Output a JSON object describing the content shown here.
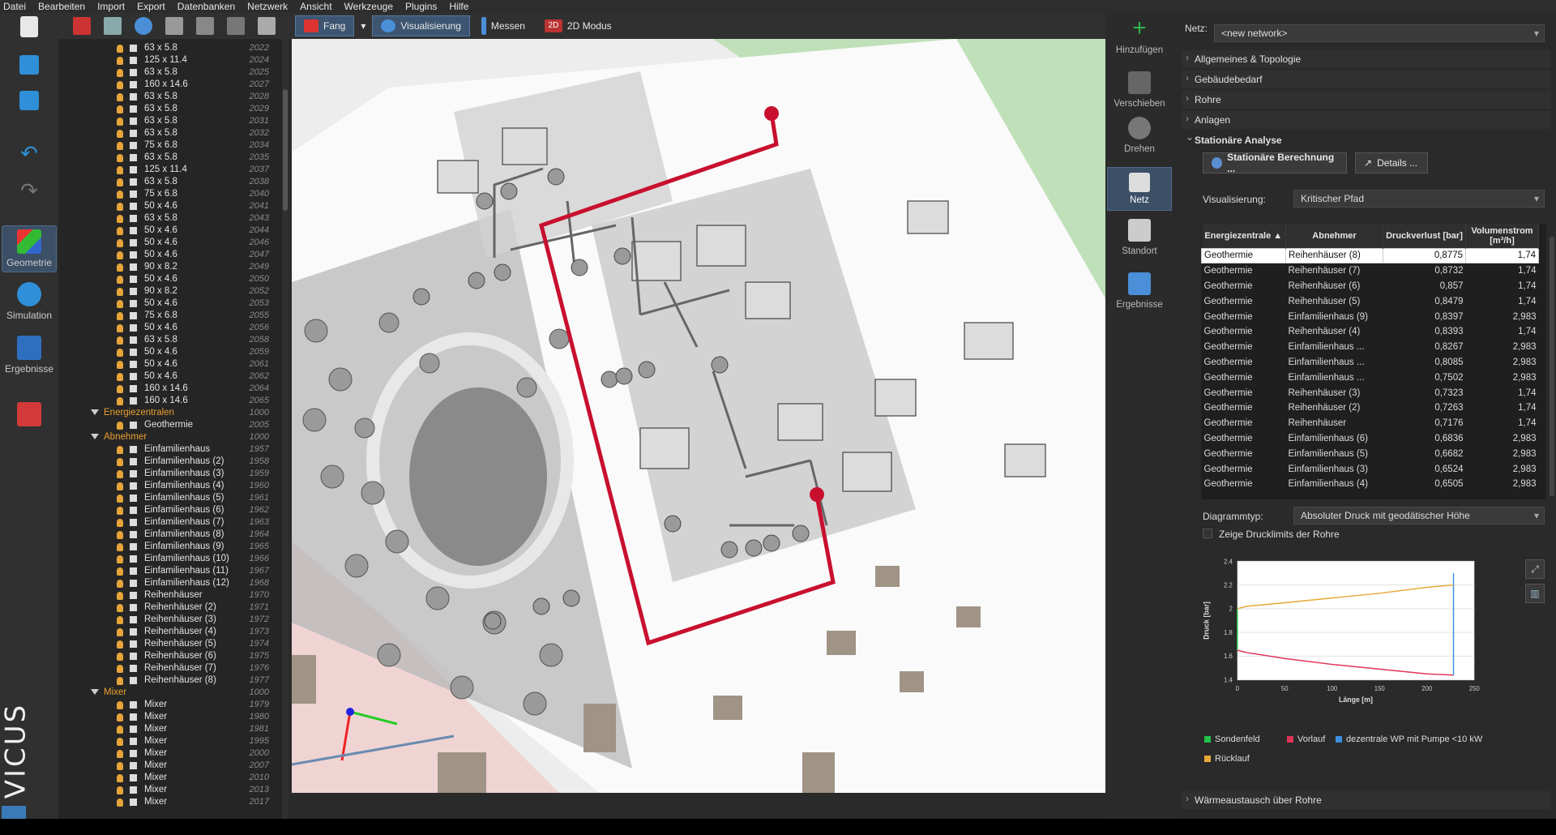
{
  "menu": [
    "Datei",
    "Bearbeiten",
    "Import",
    "Export",
    "Datenbanken",
    "Netzwerk",
    "Ansicht",
    "Werkzeuge",
    "Plugins",
    "Hilfe"
  ],
  "left_tools": [
    {
      "label": "",
      "icon": "new-file-icon"
    },
    {
      "label": "",
      "icon": "open-file-icon"
    },
    {
      "label": "",
      "icon": "save-icon"
    },
    {
      "label": "",
      "icon": "undo-icon"
    },
    {
      "label": "",
      "icon": "redo-icon"
    },
    {
      "label": "Geometrie",
      "icon": "geometry-cube-icon"
    },
    {
      "label": "Simulation",
      "icon": "simulation-play-icon"
    },
    {
      "label": "Ergebnisse",
      "icon": "results-chart-icon"
    },
    {
      "label": "",
      "icon": "export-icon"
    }
  ],
  "brand": "VICUS",
  "tree": {
    "pipes": [
      {
        "name": "63 x 5.8",
        "id": "2022"
      },
      {
        "name": "125 x 11.4",
        "id": "2024"
      },
      {
        "name": "63 x 5.8",
        "id": "2025"
      },
      {
        "name": "160 x 14.6",
        "id": "2027"
      },
      {
        "name": "63 x 5.8",
        "id": "2028"
      },
      {
        "name": "63 x 5.8",
        "id": "2029"
      },
      {
        "name": "63 x 5.8",
        "id": "2031"
      },
      {
        "name": "63 x 5.8",
        "id": "2032"
      },
      {
        "name": "75 x 6.8",
        "id": "2034"
      },
      {
        "name": "63 x 5.8",
        "id": "2035"
      },
      {
        "name": "125 x 11.4",
        "id": "2037"
      },
      {
        "name": "63 x 5.8",
        "id": "2038"
      },
      {
        "name": "75 x 6.8",
        "id": "2040"
      },
      {
        "name": "50 x 4.6",
        "id": "2041"
      },
      {
        "name": "63 x 5.8",
        "id": "2043"
      },
      {
        "name": "50 x 4.6",
        "id": "2044"
      },
      {
        "name": "50 x 4.6",
        "id": "2046"
      },
      {
        "name": "50 x 4.6",
        "id": "2047"
      },
      {
        "name": "90 x 8.2",
        "id": "2049"
      },
      {
        "name": "50 x 4.6",
        "id": "2050"
      },
      {
        "name": "90 x 8.2",
        "id": "2052"
      },
      {
        "name": "50 x 4.6",
        "id": "2053"
      },
      {
        "name": "75 x 6.8",
        "id": "2055"
      },
      {
        "name": "50 x 4.6",
        "id": "2056"
      },
      {
        "name": "63 x 5.8",
        "id": "2058"
      },
      {
        "name": "50 x 4.6",
        "id": "2059"
      },
      {
        "name": "50 x 4.6",
        "id": "2061"
      },
      {
        "name": "50 x 4.6",
        "id": "2062"
      },
      {
        "name": "160 x 14.6",
        "id": "2064"
      },
      {
        "name": "160 x 14.6",
        "id": "2065"
      }
    ],
    "group_energy": {
      "name": "Energiezentralen",
      "id": "1000"
    },
    "energy": [
      {
        "name": "Geothermie",
        "id": "2005"
      }
    ],
    "group_consumers": {
      "name": "Abnehmer",
      "id": "1000"
    },
    "consumers": [
      {
        "name": "Einfamilienhaus",
        "id": "1957"
      },
      {
        "name": "Einfamilienhaus (2)",
        "id": "1958"
      },
      {
        "name": "Einfamilienhaus (3)",
        "id": "1959"
      },
      {
        "name": "Einfamilienhaus (4)",
        "id": "1960"
      },
      {
        "name": "Einfamilienhaus (5)",
        "id": "1961"
      },
      {
        "name": "Einfamilienhaus (6)",
        "id": "1962"
      },
      {
        "name": "Einfamilienhaus (7)",
        "id": "1963"
      },
      {
        "name": "Einfamilienhaus (8)",
        "id": "1964"
      },
      {
        "name": "Einfamilienhaus (9)",
        "id": "1965"
      },
      {
        "name": "Einfamilienhaus (10)",
        "id": "1966"
      },
      {
        "name": "Einfamilienhaus (11)",
        "id": "1967"
      },
      {
        "name": "Einfamilienhaus (12)",
        "id": "1968"
      },
      {
        "name": "Reihenhäuser",
        "id": "1970"
      },
      {
        "name": "Reihenhäuser (2)",
        "id": "1971"
      },
      {
        "name": "Reihenhäuser (3)",
        "id": "1972"
      },
      {
        "name": "Reihenhäuser (4)",
        "id": "1973"
      },
      {
        "name": "Reihenhäuser (5)",
        "id": "1974"
      },
      {
        "name": "Reihenhäuser (6)",
        "id": "1975"
      },
      {
        "name": "Reihenhäuser (7)",
        "id": "1976"
      },
      {
        "name": "Reihenhäuser (8)",
        "id": "1977"
      }
    ],
    "group_mixer": {
      "name": "Mixer",
      "id": "1000"
    },
    "mixers": [
      {
        "name": "Mixer",
        "id": "1979"
      },
      {
        "name": "Mixer",
        "id": "1980"
      },
      {
        "name": "Mixer",
        "id": "1981"
      },
      {
        "name": "Mixer",
        "id": "1995"
      },
      {
        "name": "Mixer",
        "id": "2000"
      },
      {
        "name": "Mixer",
        "id": "2007"
      },
      {
        "name": "Mixer",
        "id": "2010"
      },
      {
        "name": "Mixer",
        "id": "2013"
      },
      {
        "name": "Mixer",
        "id": "2017"
      }
    ]
  },
  "view_toolbar": {
    "snap": "Fang",
    "visualization": "Visualisierung",
    "measure": "Messen",
    "mode2d": "2D Modus",
    "mode2d_badge": "2D"
  },
  "right_tools": [
    {
      "label": "Hinzufügen",
      "icon": "add-plus-icon"
    },
    {
      "label": "Verschieben",
      "icon": "move-icon"
    },
    {
      "label": "Drehen",
      "icon": "rotate-icon"
    },
    {
      "label": "Netz",
      "icon": "network-icon"
    },
    {
      "label": "Standort",
      "icon": "location-grid-icon"
    },
    {
      "label": "Ergebnisse",
      "icon": "results-bars-icon"
    }
  ],
  "panel": {
    "net_label": "Netz:",
    "net_value": "<new network>",
    "sections": [
      "Allgemeines & Topologie",
      "Gebäudebedarf",
      "Rohre",
      "Anlagen"
    ],
    "open_section": "Stationäre Analyse",
    "calc_button": "Stationäre Berechnung ...",
    "details_button": "Details ...",
    "vis_label": "Visualisierung:",
    "vis_value": "Kritischer Pfad",
    "table_headers": [
      "Energiezentrale",
      "Abnehmer",
      "Druckverlust [bar]",
      "Volumenstrom [m³/h]"
    ],
    "rows": [
      [
        "Geothermie",
        "Reihenhäuser (8)",
        "0,8775",
        "1,74"
      ],
      [
        "Geothermie",
        "Reihenhäuser (7)",
        "0,8732",
        "1,74"
      ],
      [
        "Geothermie",
        "Reihenhäuser (6)",
        "0,857",
        "1,74"
      ],
      [
        "Geothermie",
        "Reihenhäuser (5)",
        "0,8479",
        "1,74"
      ],
      [
        "Geothermie",
        "Einfamilienhaus (9)",
        "0,8397",
        "2,983"
      ],
      [
        "Geothermie",
        "Reihenhäuser (4)",
        "0,8393",
        "1,74"
      ],
      [
        "Geothermie",
        "Einfamilienhaus ...",
        "0,8267",
        "2,983"
      ],
      [
        "Geothermie",
        "Einfamilienhaus ...",
        "0,8085",
        "2,983"
      ],
      [
        "Geothermie",
        "Einfamilienhaus ...",
        "0,7502",
        "2,983"
      ],
      [
        "Geothermie",
        "Reihenhäuser (3)",
        "0,7323",
        "1,74"
      ],
      [
        "Geothermie",
        "Reihenhäuser (2)",
        "0,7263",
        "1,74"
      ],
      [
        "Geothermie",
        "Reihenhäuser",
        "0,7176",
        "1,74"
      ],
      [
        "Geothermie",
        "Einfamilienhaus (6)",
        "0,6836",
        "2,983"
      ],
      [
        "Geothermie",
        "Einfamilienhaus (5)",
        "0,6682",
        "2,983"
      ],
      [
        "Geothermie",
        "Einfamilienhaus (3)",
        "0,6524",
        "2,983"
      ],
      [
        "Geothermie",
        "Einfamilienhaus (4)",
        "0,6505",
        "2,983"
      ]
    ],
    "diag_label": "Diagrammtyp:",
    "diag_value": "Absoluter Druck mit geodätischer Höhe",
    "show_limits": "Zeige Drucklimits der Rohre",
    "bottom_section": "Wärmeaustausch über Rohre"
  },
  "chart_data": {
    "type": "line",
    "xlabel": "Länge [m]",
    "ylabel": "Druck [bar]",
    "xlim": [
      0,
      250
    ],
    "ylim": [
      1.4,
      2.4
    ],
    "xticks": [
      0,
      50,
      100,
      150,
      200,
      250
    ],
    "yticks": [
      1.4,
      1.6,
      1.8,
      2,
      2.2,
      2.4
    ],
    "series": [
      {
        "name": "Sondenfeld",
        "color": "#22c24a",
        "x": [
          0,
          0
        ],
        "y": [
          1.65,
          2.0
        ]
      },
      {
        "name": "Vorlauf",
        "color": "#e0335a",
        "x": [
          0,
          10,
          50,
          100,
          150,
          200,
          228
        ],
        "y": [
          1.65,
          1.63,
          1.58,
          1.53,
          1.49,
          1.45,
          1.44
        ]
      },
      {
        "name": "dezentrale WP mit Pumpe <10 kW",
        "color": "#3a8fe0",
        "x": [
          228,
          228
        ],
        "y": [
          1.44,
          2.3
        ]
      },
      {
        "name": "Rücklauf",
        "color": "#e8a838",
        "x": [
          0,
          10,
          50,
          100,
          150,
          200,
          228
        ],
        "y": [
          2.0,
          2.02,
          2.05,
          2.09,
          2.13,
          2.18,
          2.2
        ]
      }
    ]
  },
  "colors": {
    "accent": "#3b4f66",
    "critical_path": "#c8102e",
    "bulb": "#e6a43a"
  }
}
